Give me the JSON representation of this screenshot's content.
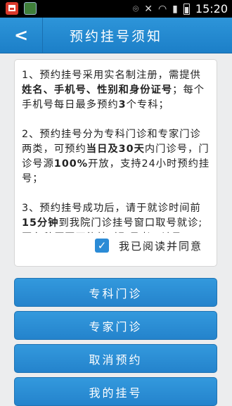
{
  "status_bar": {
    "time": "15:20",
    "icons": [
      "notification-app-icon",
      "notification-image-icon",
      "location-icon",
      "mute-icon",
      "wifi-icon",
      "signal-icon",
      "battery-icon"
    ]
  },
  "header": {
    "back_icon": "back-arrow-icon",
    "title": "预约挂号须知"
  },
  "notice": {
    "paragraphs": [
      {
        "prefix": "1、预约挂号采用实名制注册，需提供",
        "bold": "姓名、手机号、性别和身份证号",
        "mid": "；每个手机号每日最多预约",
        "bold2": "3",
        "suffix": "个专科；"
      },
      {
        "prefix": "2、预约挂号分为专科门诊和专家门诊两类，可预约",
        "bold": "当日及30天",
        "mid": "内门诊号，门诊号源",
        "bold2": "100%",
        "suffix": "开放，支持24小时预约挂号；"
      },
      {
        "prefix": "3、预约挂号成功后，请于就诊时间前",
        "bold": "15分钟",
        "mid": "到我院门诊挂号窗口取号就诊;因各种原因不能按时取号者，请及",
        "bold2": "",
        "suffix": ""
      }
    ],
    "checkbox_checked": true,
    "agree_label": "我已阅读并同意"
  },
  "buttons": {
    "specialty": "专科门诊",
    "expert": "专家门诊",
    "cancel": "取消预约",
    "more": "我的挂号"
  },
  "colors": {
    "accent": "#2483cc",
    "background": "#ecedee"
  }
}
